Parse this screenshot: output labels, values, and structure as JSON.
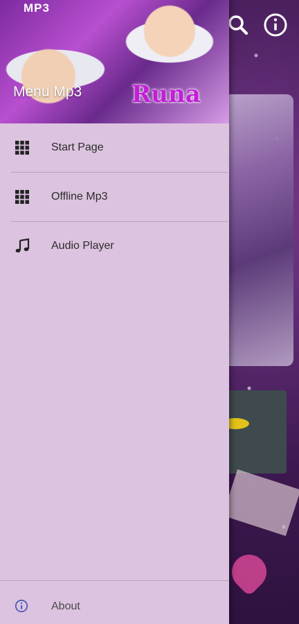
{
  "header": {
    "logo_text": "MP3",
    "title": "Menu Mp3",
    "deco_text": "Runa"
  },
  "drawer": {
    "items": [
      {
        "label": "Start Page",
        "icon": "grid-icon"
      },
      {
        "label": "Offline Mp3",
        "icon": "grid-icon"
      },
      {
        "label": "Audio Player",
        "icon": "music-note-icon"
      }
    ],
    "footer": {
      "label": "About",
      "icon": "info-circle-icon"
    }
  },
  "background": {
    "toolbar_icons": [
      "search-icon",
      "info-icon"
    ]
  },
  "colors": {
    "drawer_bg": "#dcc3df",
    "divider": "#b7a2bb",
    "text": "#2b2b2b",
    "accent": "#3f51b5"
  }
}
